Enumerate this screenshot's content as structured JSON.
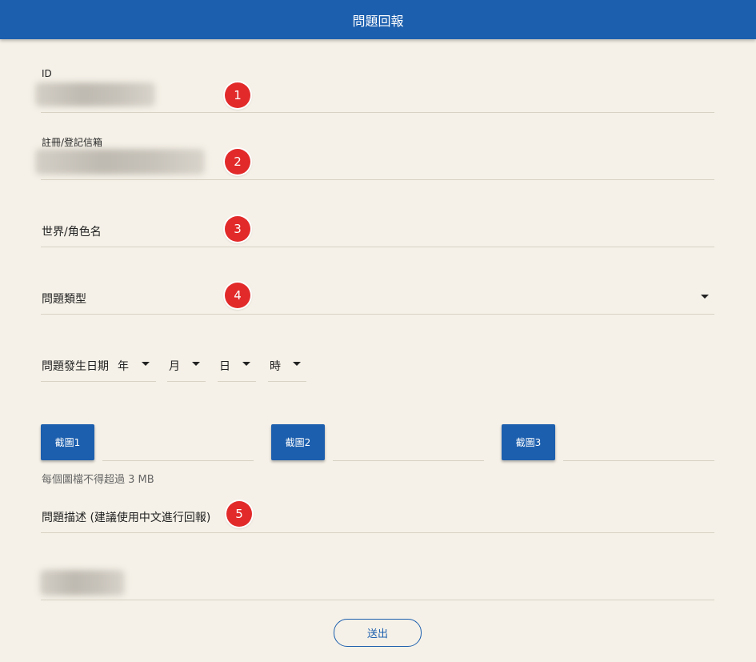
{
  "header": {
    "title": "問題回報"
  },
  "form": {
    "id_label": "ID",
    "email_label": "註冊/登記信箱",
    "world_label": "世界/角色名",
    "issue_type_label": "問題類型",
    "date_label": "問題發生日期",
    "year_label": "年",
    "month_label": "月",
    "day_label": "日",
    "hour_label": "時",
    "screenshot_buttons": [
      "截圖1",
      "截圖2",
      "截圖3"
    ],
    "file_hint": "每個圖檔不得超過 3 MB",
    "description_label": "問題描述 (建議使用中文進行回報)",
    "submit_label": "送出"
  },
  "badges": [
    "1",
    "2",
    "3",
    "4",
    "5"
  ],
  "colors": {
    "brand": "#1c5fae",
    "badge": "#e22a2a",
    "background": "#f5f1e8"
  }
}
